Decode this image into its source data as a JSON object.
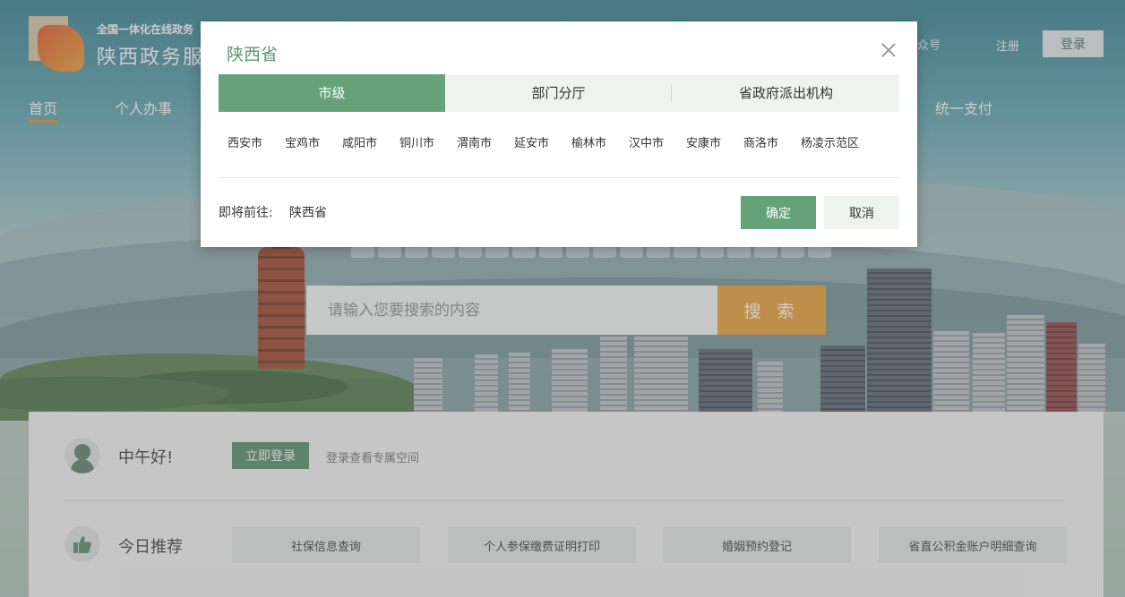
{
  "header": {
    "tagline": "全国一体化在线政务",
    "site_name": "陕西政务服",
    "gzh_label": "众号",
    "register_label": "注册",
    "login_label": "登录"
  },
  "nav": {
    "items": [
      {
        "label": "首页"
      },
      {
        "label": "个人办事"
      },
      {
        "label": "统一支付"
      }
    ]
  },
  "search": {
    "placeholder": "请输入您要搜索的内容",
    "button_label": "搜 索"
  },
  "panel": {
    "greeting": "中午好!",
    "login_now_label": "立即登录",
    "login_hint": "登录查看专属空间",
    "recommend_title": "今日推荐",
    "recommendations": [
      {
        "label": "社保信息查询"
      },
      {
        "label": "个人参保缴费证明打印"
      },
      {
        "label": "婚姻预约登记"
      },
      {
        "label": "省直公积金账户明细查询"
      }
    ]
  },
  "modal": {
    "title": "陕西省",
    "tabs": [
      {
        "label": "市级"
      },
      {
        "label": "部门分厅"
      },
      {
        "label": "省政府派出机构"
      }
    ],
    "cities": [
      {
        "label": "西安市"
      },
      {
        "label": "宝鸡市"
      },
      {
        "label": "咸阳市"
      },
      {
        "label": "铜川市"
      },
      {
        "label": "渭南市"
      },
      {
        "label": "延安市"
      },
      {
        "label": "榆林市"
      },
      {
        "label": "汉中市"
      },
      {
        "label": "安康市"
      },
      {
        "label": "商洛市"
      },
      {
        "label": "杨凌示范区"
      }
    ],
    "goto_label": "即将前往:",
    "goto_value": "陕西省",
    "confirm_label": "确定",
    "cancel_label": "取消"
  },
  "colors": {
    "accent_green": "#65a27a",
    "search_orange": "#e89d2f",
    "nav_underline": "#e98a2e"
  }
}
